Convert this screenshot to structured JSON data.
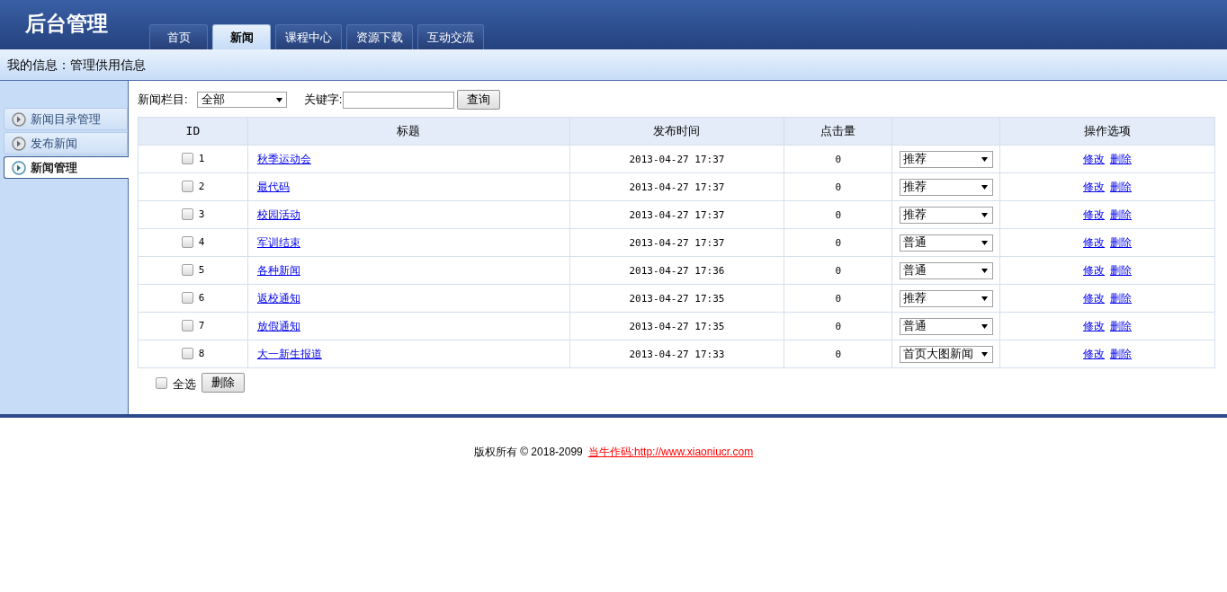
{
  "header": {
    "title": "后台管理",
    "tabs": [
      {
        "label": "首页",
        "selected": false
      },
      {
        "label": "新闻",
        "selected": true
      },
      {
        "label": "课程中心",
        "selected": false
      },
      {
        "label": "资源下载",
        "selected": false
      },
      {
        "label": "互动交流",
        "selected": false
      }
    ]
  },
  "info_bar": "我的信息：管理供用信息",
  "sidebar": {
    "items": [
      {
        "label": "新闻目录管理",
        "selected": false
      },
      {
        "label": "发布新闻",
        "selected": false
      },
      {
        "label": "新闻管理",
        "selected": true
      }
    ]
  },
  "filter": {
    "category_label": "新闻栏目:",
    "category_value": "全部",
    "keyword_label": "关键字:",
    "search_button": "查询"
  },
  "table": {
    "columns": [
      "ID",
      "标题",
      "发布时间",
      "点击量",
      "操作选项"
    ],
    "rows": [
      {
        "checked": false,
        "id": "1",
        "title": "秋季运动会",
        "time": "2013-04-27 17:37",
        "clicks": "0",
        "status": "推荐",
        "actions": [
          "修改",
          "删除"
        ]
      },
      {
        "checked": false,
        "id": "2",
        "title": "最代码",
        "time": "2013-04-27 17:37",
        "clicks": "0",
        "status": "推荐",
        "actions": [
          "修改",
          "删除"
        ]
      },
      {
        "checked": false,
        "id": "3",
        "title": "校园活动",
        "time": "2013-04-27 17:37",
        "clicks": "0",
        "status": "推荐",
        "actions": [
          "修改",
          "删除"
        ]
      },
      {
        "checked": false,
        "id": "4",
        "title": "军训结束",
        "time": "2013-04-27 17:37",
        "clicks": "0",
        "status": "普通",
        "actions": [
          "修改",
          "删除"
        ]
      },
      {
        "checked": false,
        "id": "5",
        "title": "各种新闻",
        "time": "2013-04-27 17:36",
        "clicks": "0",
        "status": "普通",
        "actions": [
          "修改",
          "删除"
        ]
      },
      {
        "checked": false,
        "id": "6",
        "title": "返校通知",
        "time": "2013-04-27 17:35",
        "clicks": "0",
        "status": "推荐",
        "actions": [
          "修改",
          "删除"
        ]
      },
      {
        "checked": false,
        "id": "7",
        "title": "放假通知",
        "time": "2013-04-27 17:35",
        "clicks": "0",
        "status": "普通",
        "actions": [
          "修改",
          "删除"
        ]
      },
      {
        "checked": false,
        "id": "8",
        "title": "大一新生报道",
        "time": "2013-04-27 17:33",
        "clicks": "0",
        "status": "首页大图新闻",
        "actions": [
          "修改",
          "删除"
        ]
      }
    ]
  },
  "bulk": {
    "select_all_label": "全选",
    "select_all_checked": false,
    "delete_button": "删除"
  },
  "footer": {
    "text": "版权所有 © 2018-2099",
    "link": "当牛作码:http://www.xiaoniucr.com"
  }
}
